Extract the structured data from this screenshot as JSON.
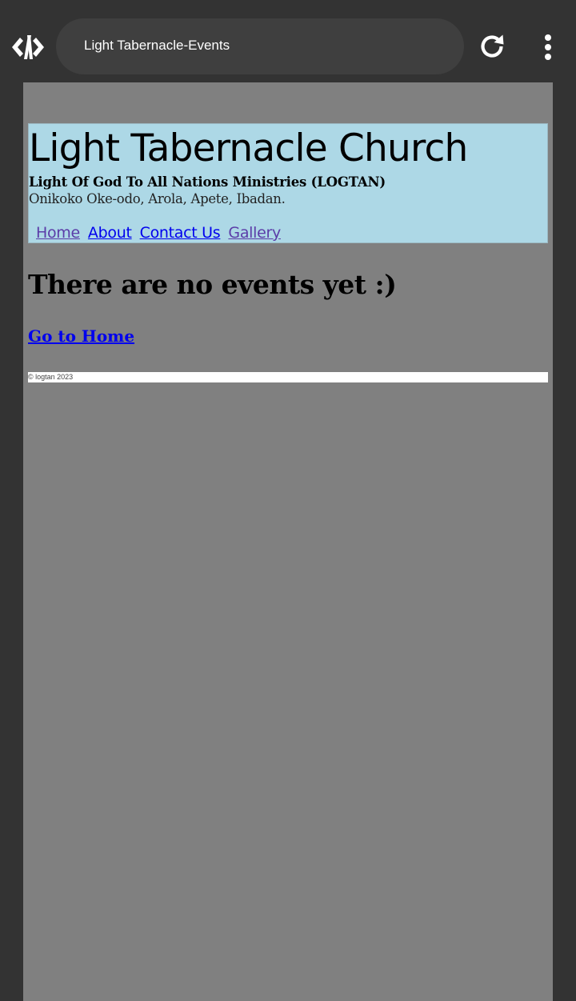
{
  "browser": {
    "tab_title": "Light Tabernacle-Events",
    "logo_icon": "code-brackets-logo-icon",
    "reload_icon": "reload-icon",
    "menu_icon": "more-vert-icon"
  },
  "site": {
    "title": "Light Tabernacle Church",
    "subtitle": "Light Of God To All Nations Ministries (LOGTAN)",
    "address": "Onikoko Oke-odo, Arola, Apete, Ibadan.",
    "nav": [
      {
        "label": "Home"
      },
      {
        "label": "About"
      },
      {
        "label": "Contact Us"
      },
      {
        "label": "Gallery"
      }
    ]
  },
  "main": {
    "message": "There are no events yet :)",
    "home_link": "Go to Home"
  },
  "footer": {
    "text": "© logtan 2023"
  },
  "colors": {
    "chrome_bg": "#333333",
    "pill_bg": "#3f3f3f",
    "page_bg": "#808080",
    "header_bg": "#add8e6",
    "link": "#0000ee",
    "visited_link": "#5b3ca8"
  }
}
